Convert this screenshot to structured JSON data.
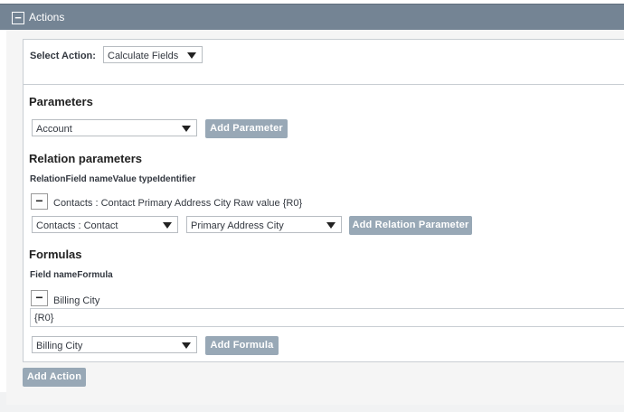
{
  "header": {
    "title": "Actions",
    "collapse_symbol": "−"
  },
  "select_action": {
    "label": "Select Action:",
    "value": "Calculate Fields"
  },
  "parameters": {
    "title": "Parameters",
    "select_value": "Account",
    "add_button": "Add Parameter"
  },
  "relation_parameters": {
    "title": "Relation parameters",
    "columns": "RelationField nameValue typeIdentifier",
    "row": {
      "remove_symbol": "−",
      "text": "Contacts : Contact Primary Address City Raw value {R0}"
    },
    "relation_select_value": "Contacts : Contact",
    "field_select_value": "Primary Address City",
    "add_button": "Add Relation Parameter"
  },
  "formulas": {
    "title": "Formulas",
    "columns": "Field nameFormula",
    "row": {
      "remove_symbol": "−",
      "text": "Billing City"
    },
    "formula_value": "{R0}",
    "field_select_value": "Billing City",
    "add_button": "Add Formula"
  },
  "add_action_button": "Add Action",
  "icons": {
    "dropdown": "caret-down-icon",
    "collapse": "minus-square-icon"
  }
}
